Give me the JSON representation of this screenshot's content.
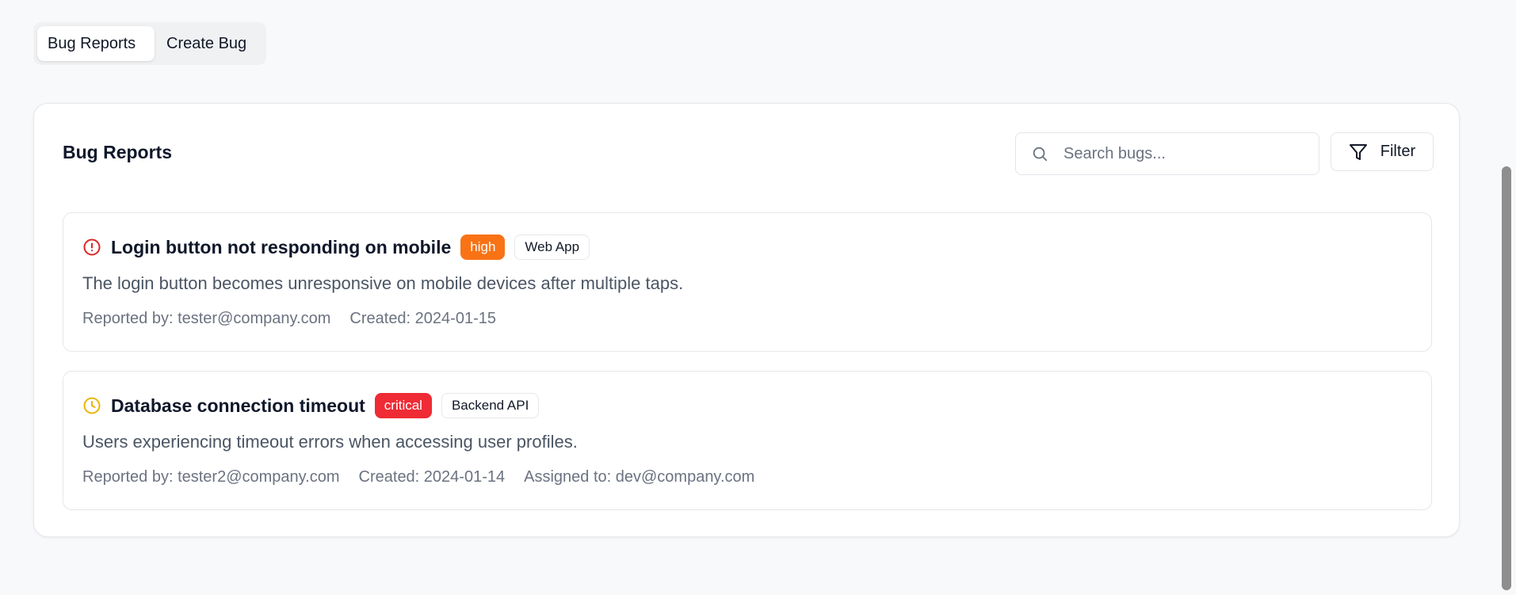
{
  "tabs": [
    {
      "label": "Bug Reports",
      "active": true
    },
    {
      "label": "Create Bug",
      "active": false
    }
  ],
  "panel": {
    "title": "Bug Reports",
    "search": {
      "placeholder": "Search bugs...",
      "value": ""
    },
    "filter_label": "Filter"
  },
  "bugs": [
    {
      "status_icon": "alert-circle-icon",
      "status_color": "#dc2626",
      "title": "Login button not responding on mobile",
      "severity": "high",
      "severity_color": "#f97316",
      "component": "Web App",
      "description": "The login button becomes unresponsive on mobile devices after multiple taps.",
      "reported_by": "Reported by: tester@company.com",
      "created": "Created: 2024-01-15"
    },
    {
      "status_icon": "clock-icon",
      "status_color": "#eab308",
      "title": "Database connection timeout",
      "severity": "critical",
      "severity_color": "#ef2b35",
      "component": "Backend API",
      "description": "Users experiencing timeout errors when accessing user profiles.",
      "reported_by": "Reported by: tester2@company.com",
      "created": "Created: 2024-01-14",
      "assigned_to": "Assigned to: dev@company.com"
    }
  ]
}
